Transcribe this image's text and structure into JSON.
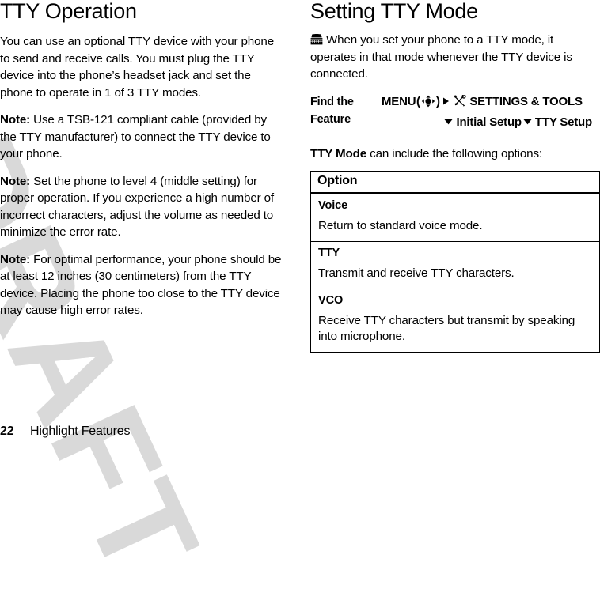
{
  "watermark": {
    "text": "DRAFT",
    "color": "#d9d9d9"
  },
  "left_column": {
    "title": "TTY Operation",
    "paragraphs": [
      {
        "label": "",
        "text": "You can use an optional TTY device with your phone to send and receive calls. You must plug the TTY device into the phone’s headset jack and set the phone to operate in 1 of 3 TTY modes."
      },
      {
        "label": "Note:",
        "text": "Use a TSB-121 compliant cable (provided by the TTY manufacturer) to connect the TTY device to your phone."
      },
      {
        "label": "Note:",
        "text": "Set the phone to level 4 (middle setting) for proper operation. If you experience a high number of incorrect characters, adjust the volume as needed to minimize the error rate."
      },
      {
        "label": "Note:",
        "text": "For optimal performance, your phone should be at least 12 inches (30 centimeters) from the TTY device. Placing the phone too close to the TTY device may cause high error rates."
      }
    ]
  },
  "right_column": {
    "title": "Setting TTY Mode",
    "intro_icon": "tty-teletypewriter-icon",
    "intro_text": "When you set your phone to a TTY mode, it operates in that mode whenever the TTY device is connected.",
    "find_feature": {
      "label_line_1": "Find the",
      "label_line_2": "Feature",
      "menu_label": "MENU",
      "menu_key_icon": "four-way-navigation-key-icon",
      "arrow_right_icon": "arrow-right-icon",
      "tools_icon": "settings-tools-icon",
      "settings_label": "SETTINGS & TOOLS",
      "arrow_down_icon": "arrow-down-icon",
      "step_2": "Initial Setup",
      "step_3": "TTY Setup"
    },
    "table_intro_bold": "TTY Mode",
    "table_intro_rest": " can include the following options:",
    "table": {
      "header": "Option",
      "rows": [
        {
          "name": "Voice",
          "description": "Return to standard voice mode."
        },
        {
          "name": "TTY",
          "description": "Transmit and receive TTY characters."
        },
        {
          "name": "VCO",
          "description": "Receive TTY characters but transmit by speaking into microphone."
        }
      ]
    }
  },
  "footer": {
    "page_number": "22",
    "title": "Highlight Features"
  }
}
